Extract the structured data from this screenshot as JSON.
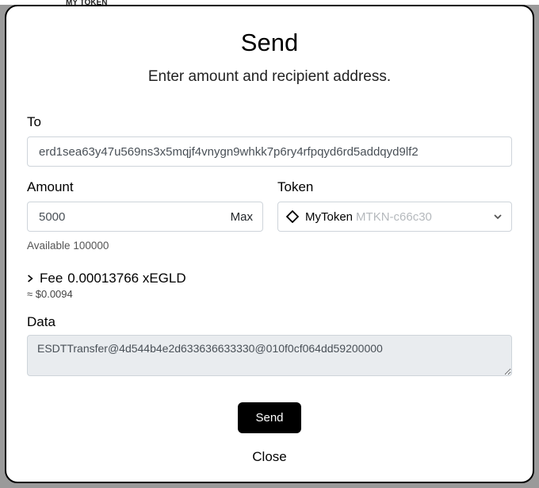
{
  "background": {
    "snippet": "MY TOKEN"
  },
  "modal": {
    "title": "Send",
    "subtitle": "Enter amount and recipient address."
  },
  "to": {
    "label": "To",
    "value": "erd1sea63y47u569ns3x5mqjf4vnygn9whkk7p6ry4rfpqyd6rd5addqyd9lf2"
  },
  "amount": {
    "label": "Amount",
    "value": "5000",
    "max_label": "Max",
    "available_prefix": "Available",
    "available_value": "100000"
  },
  "token": {
    "label": "Token",
    "icon_name": "diamond-icon",
    "name": "MyToken",
    "ticker": "MTKN-c66c30"
  },
  "fee": {
    "label": "Fee",
    "value": "0.00013766 xEGLD",
    "usd": "≈ $0.0094"
  },
  "data_field": {
    "label": "Data",
    "value": "ESDTTransfer@4d544b4e2d633636633330@010f0cf064dd59200000"
  },
  "buttons": {
    "send": "Send",
    "close": "Close"
  }
}
